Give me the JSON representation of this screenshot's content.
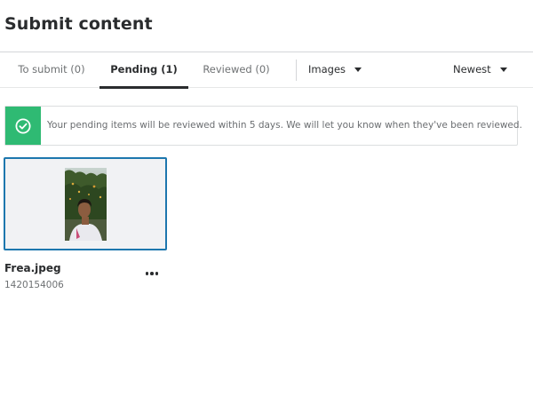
{
  "page": {
    "title": "Submit content"
  },
  "tabs": [
    {
      "label": "To submit (0)",
      "active": false
    },
    {
      "label": "Pending (1)",
      "active": true
    },
    {
      "label": "Reviewed (0)",
      "active": false
    }
  ],
  "filters": {
    "type": {
      "selected": "Images",
      "icon": "caret-down-icon"
    },
    "sort": {
      "selected": "Newest",
      "icon": "caret-down-icon"
    }
  },
  "notice": {
    "icon": "check-circle-icon",
    "text": "Your pending items will be reviewed within 5 days. We will let you know when they've been reviewed.",
    "accent": "#2fba73"
  },
  "items": [
    {
      "name": "Frea.jpeg",
      "id": "1420154006",
      "selected": true,
      "menu_icon": "more-options-icon"
    }
  ],
  "colors": {
    "selection_border": "#1d77ae",
    "text_dark": "#2a2c2e",
    "text_muted": "#6e7173"
  }
}
